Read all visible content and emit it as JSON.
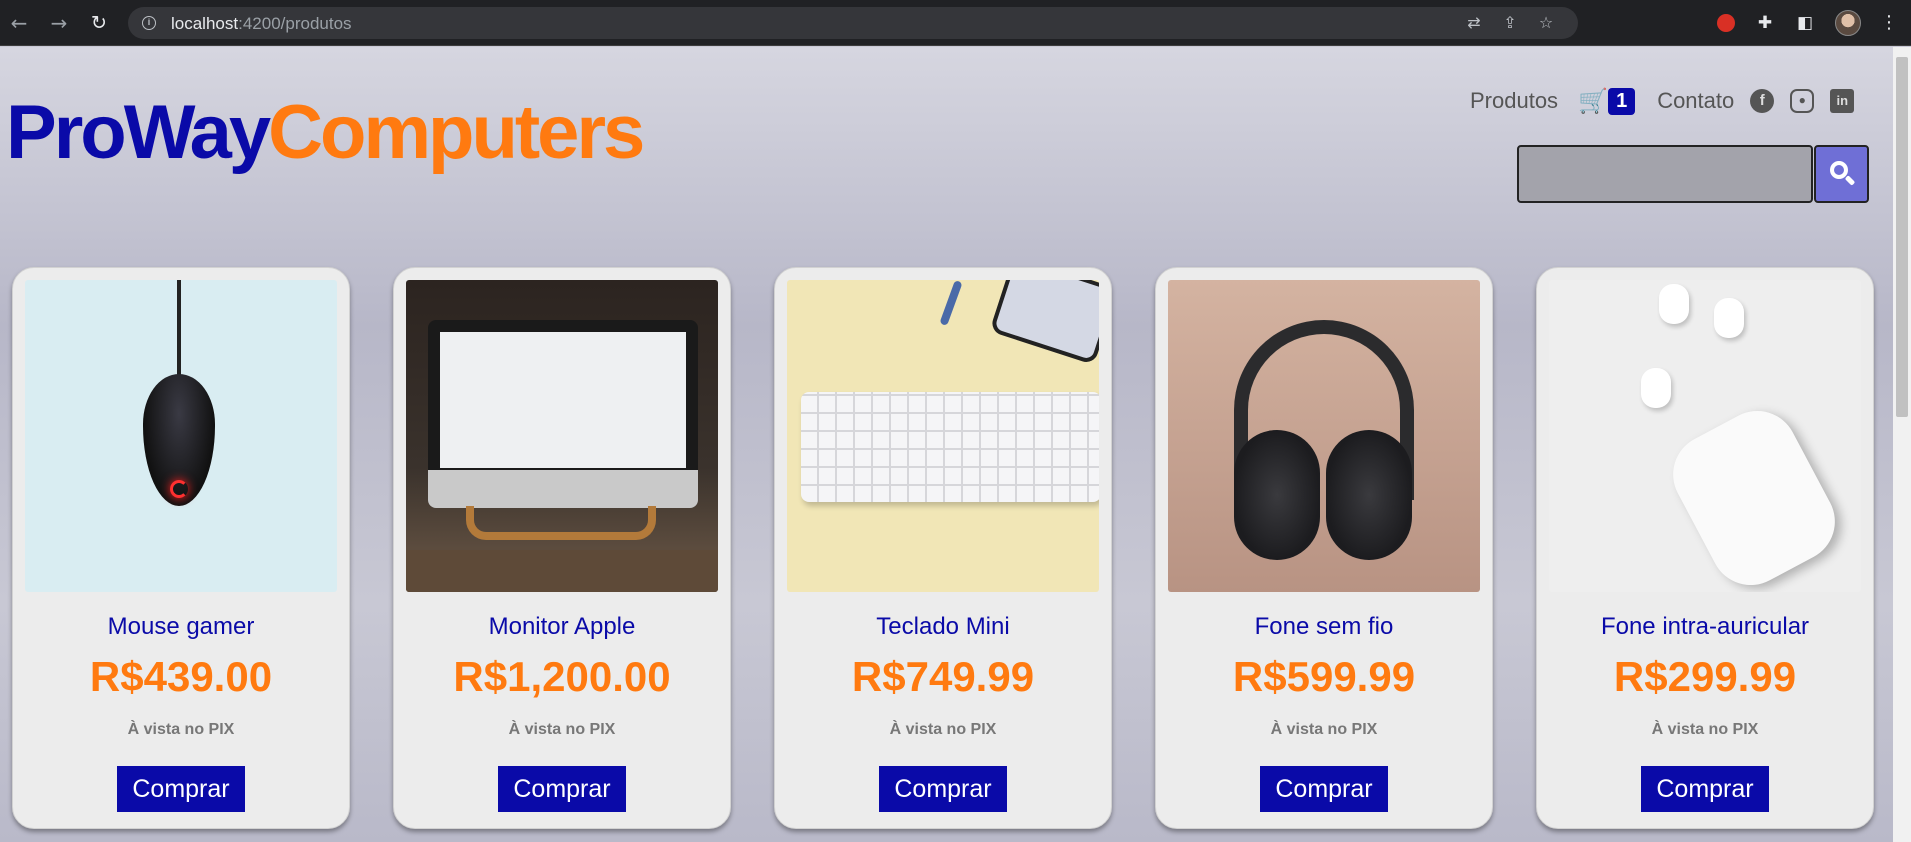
{
  "browser": {
    "url_host": "localhost",
    "url_path": ":4200/produtos"
  },
  "header": {
    "logo_part1": "ProWay",
    "logo_part2": "Computers",
    "nav_produtos": "Produtos",
    "cart_count": "1",
    "nav_contato": "Contato",
    "social": [
      "facebook-icon",
      "instagram-icon",
      "linkedin-icon"
    ]
  },
  "search": {
    "value": "",
    "placeholder": ""
  },
  "colors": {
    "brand_blue": "#0a0aa8",
    "brand_orange": "#ff7a10",
    "search_button": "#6f6fd6"
  },
  "products": [
    {
      "name": "Mouse gamer",
      "price": "R$439.00",
      "note": "À vista no PIX",
      "buy": "Comprar"
    },
    {
      "name": "Monitor Apple",
      "price": "R$1,200.00",
      "note": "À vista no PIX",
      "buy": "Comprar"
    },
    {
      "name": "Teclado Mini",
      "price": "R$749.99",
      "note": "À vista no PIX",
      "buy": "Comprar"
    },
    {
      "name": "Fone sem fio",
      "price": "R$599.99",
      "note": "À vista no PIX",
      "buy": "Comprar"
    },
    {
      "name": "Fone intra-auricular",
      "price": "R$299.99",
      "note": "À vista no PIX",
      "buy": "Comprar"
    }
  ]
}
